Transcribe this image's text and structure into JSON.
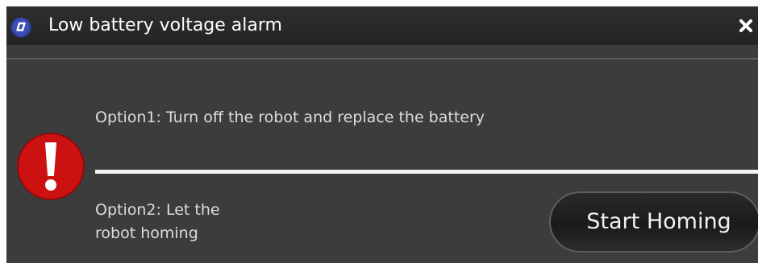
{
  "window": {
    "title": "Low battery voltage alarm",
    "app_icon": "app-logo-icon",
    "close_icon": "close-icon"
  },
  "alert": {
    "icon": "error-exclamation-icon",
    "icon_color": "#cc1111"
  },
  "options": {
    "option1": "Option1: Turn off the robot and replace the battery",
    "option2_line1": "Option2: Let the",
    "option2_line2": "robot homing"
  },
  "actions": {
    "start_homing_label": "Start Homing"
  },
  "colors": {
    "dialog_bg": "#3c3c3c",
    "titlebar_bg": "#2a2a2a",
    "text": "#dcdcdc",
    "divider": "#f2f2f2",
    "app_icon_bg": "#2f3f9a"
  }
}
